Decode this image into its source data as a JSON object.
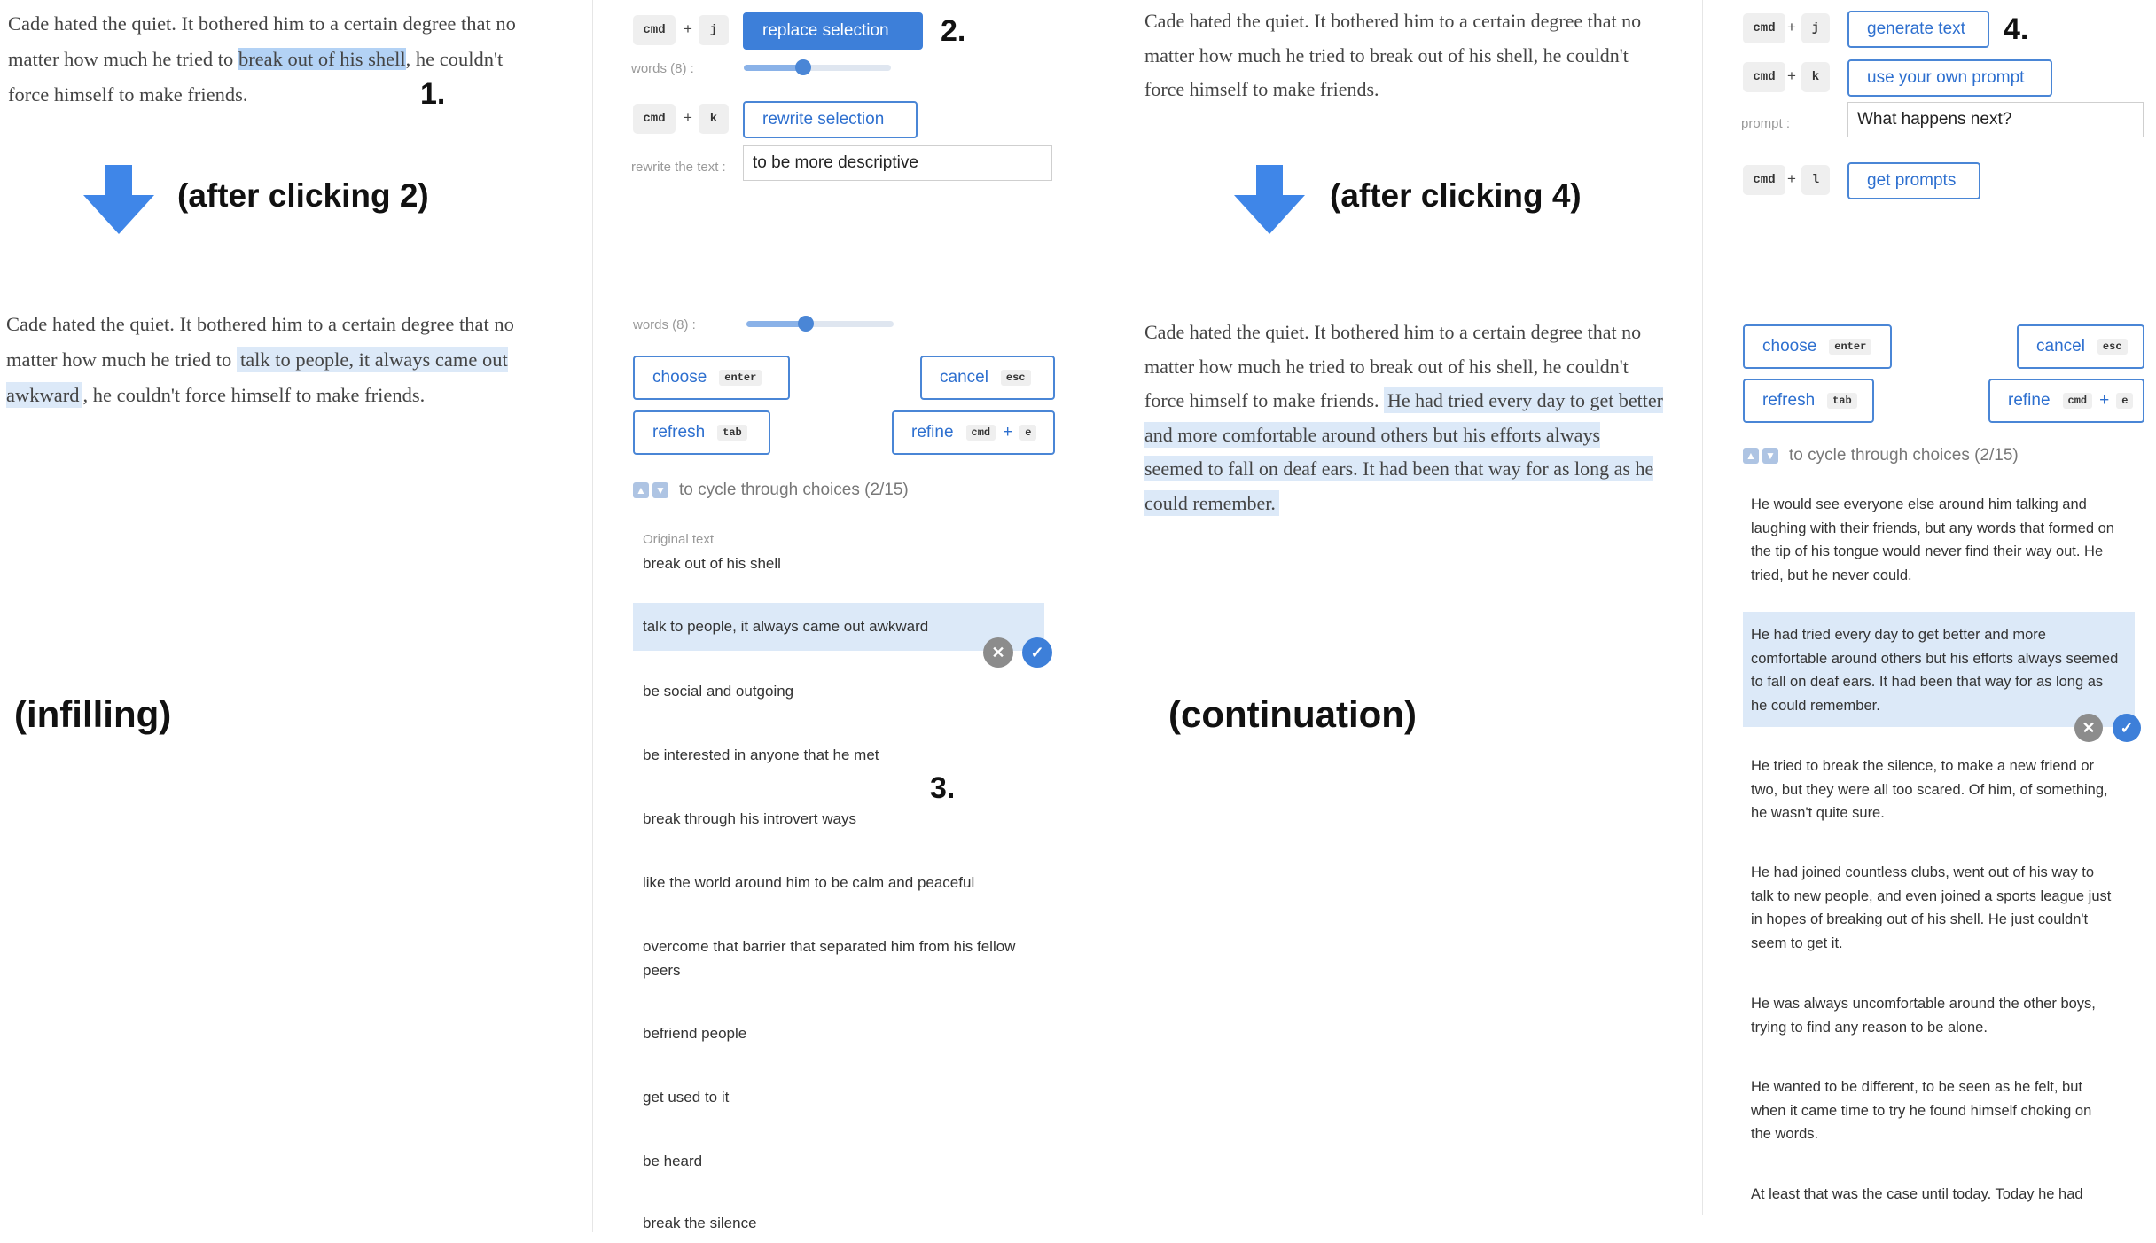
{
  "colors": {
    "accent": "#3d7fd9",
    "selection": "#b3d2f5",
    "inserted": "#dce9f8",
    "arrow": "#3f86e8"
  },
  "labels": {
    "n1": "1.",
    "n2": "2.",
    "n3": "3.",
    "n4": "4.",
    "after2": "(after clicking 2)",
    "after4": "(after clicking 4)",
    "infilling": "(infilling)",
    "continuation": "(continuation)"
  },
  "keys": {
    "cmd": "cmd",
    "j": "j",
    "k": "k",
    "l": "l",
    "plus": "+",
    "enter": "enter",
    "esc": "esc",
    "tab": "tab",
    "e": "e"
  },
  "infill_top": {
    "pre": "Cade hated the quiet. It bothered him to a certain degree that no matter how much he tried to ",
    "selected": "break out of his shell",
    "post": ", he couldn't force himself to make friends."
  },
  "infill_bottom": {
    "pre": "Cade hated the quiet. It bothered him to a certain degree that no matter how much he tried to ",
    "inserted": "talk to people, it always came out awkward",
    "post": ", he couldn't force himself to make friends."
  },
  "infill_controls": {
    "replace_label": "replace selection",
    "words_label": "words (8) :",
    "words_fraction": 0.4,
    "rewrite_label": "rewrite selection",
    "rewrite_text_label": "rewrite the text :",
    "rewrite_value": "to be more descriptive"
  },
  "infill_choices": {
    "words_label": "words (8) :",
    "words_fraction": 0.4,
    "choose_label": "choose",
    "cancel_label": "cancel",
    "refresh_label": "refresh",
    "refine_label": "refine",
    "cycle_text": "to cycle through choices (2/15)",
    "original_label": "Original text",
    "original_value": "break out of his shell",
    "items": [
      "talk to people, it always came out awkward",
      "be social and outgoing",
      "be interested in anyone that he met",
      "break through his introvert ways",
      "like the world around him to be calm and peaceful",
      "overcome that barrier that separated him from his fellow peers",
      "befriend people",
      "get used to it",
      "be heard",
      "break the silence"
    ]
  },
  "cont_top": {
    "text": "Cade hated the quiet. It bothered him to a certain degree that no matter how much he tried to break out of his shell, he couldn't force himself to make friends."
  },
  "cont_bottom": {
    "pre": "Cade hated the quiet. It bothered him to a certain degree that no matter how much he tried to break out of his shell, he couldn't force himself to make friends. ",
    "inserted": "He had tried every day to get better and more comfortable around others but his efforts always seemed to fall on deaf ears. It had been that way for as long as he could remember."
  },
  "cont_controls": {
    "generate_label": "generate text",
    "own_prompt_label": "use your own prompt",
    "prompt_label": "prompt :",
    "prompt_value": "What happens next?",
    "get_prompts_label": "get prompts"
  },
  "cont_choices": {
    "choose_label": "choose",
    "cancel_label": "cancel",
    "refresh_label": "refresh",
    "refine_label": "refine",
    "cycle_text": "to cycle through choices (2/15)",
    "items": [
      "He would see everyone else around him talking and laughing with their friends, but any words that formed on the tip of his tongue would never find their way out. He tried, but he never could.",
      "He had tried every day to get better and more comfortable around others but his efforts always seemed to fall on deaf ears. It had been that way for as long as he could remember.",
      "He tried to break the silence, to make a new friend or two, but they were all too scared. Of him, of something, he wasn't quite sure.",
      "He had joined countless clubs, went out of his way to talk to new people, and even joined a sports league just in hopes of breaking out of his shell. He just couldn't seem to get it.",
      "He was always uncomfortable around the other boys, trying to find any reason to be alone.",
      "He wanted to be different, to be seen as he felt, but when it came time to try he found himself choking on the words.",
      "At least that was the case until today. Today he had"
    ]
  },
  "icons": {
    "down_arrow": "down-arrow-icon",
    "up": "▲",
    "down": "▼",
    "close": "✕",
    "check": "✓"
  }
}
